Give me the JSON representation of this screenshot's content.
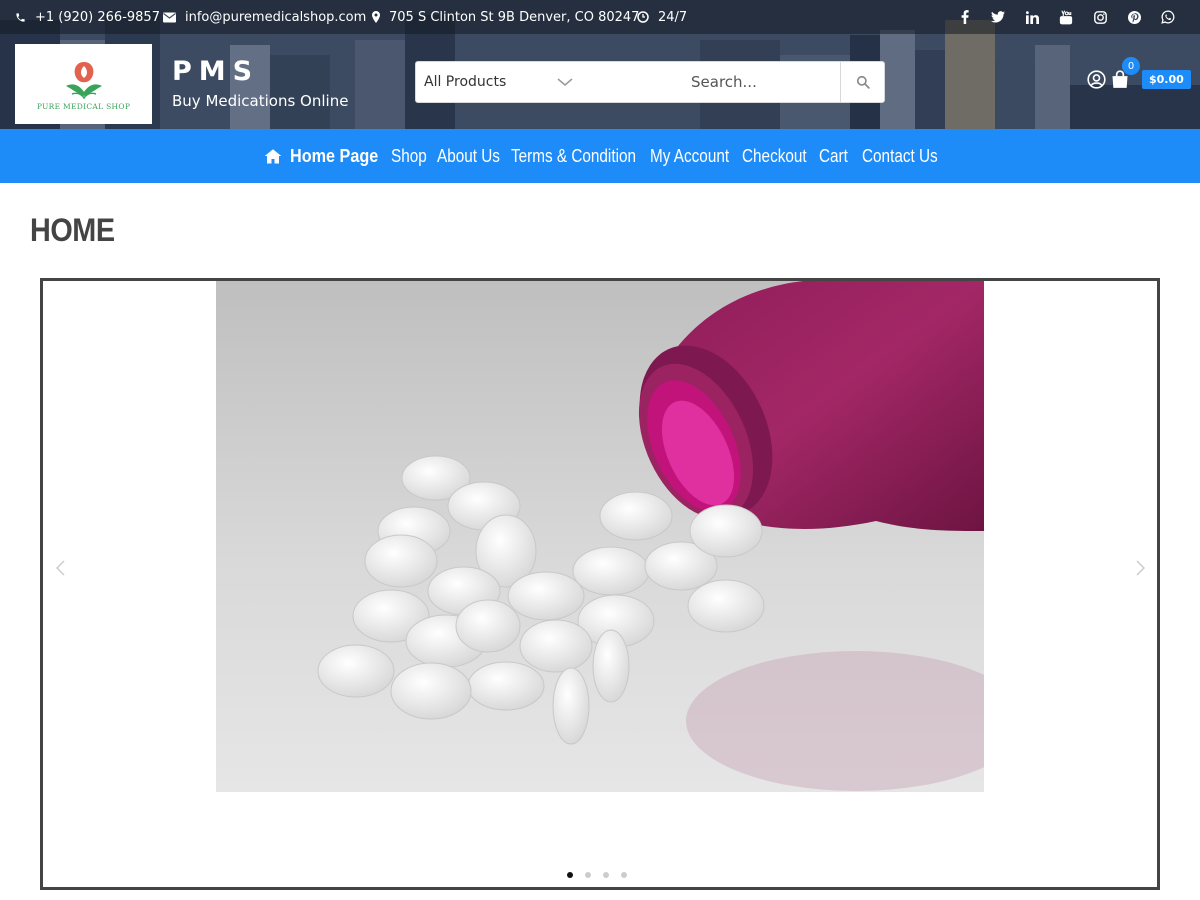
{
  "topbar": {
    "phone": "+1 (920) 266-9857",
    "email": "info@puremedicalshop.com",
    "address": "705 S Clinton St 9B Denver, CO 80247",
    "hours": "24/7",
    "social_icons": [
      "facebook-icon",
      "twitter-icon",
      "linkedin-icon",
      "youtube-icon",
      "instagram-icon",
      "pinterest-icon",
      "whatsapp-icon"
    ]
  },
  "brand": {
    "logo_text": "PURE MEDICAL SHOP",
    "title": "PMS",
    "tagline": "Buy Medications Online"
  },
  "search": {
    "category": "All Products",
    "placeholder": "Search..."
  },
  "cart": {
    "count": "0",
    "total": "$0.00"
  },
  "nav": {
    "items": [
      {
        "label": "Home Page",
        "active": true
      },
      {
        "label": "Shop"
      },
      {
        "label": "About Us"
      },
      {
        "label": "Terms & Condition"
      },
      {
        "label": "My Account"
      },
      {
        "label": "Checkout"
      },
      {
        "label": "Cart"
      },
      {
        "label": "Contact Us"
      }
    ]
  },
  "page": {
    "title": "HOME"
  },
  "slider": {
    "slide_count": 4,
    "active_slide": 1,
    "image": "white-pills-spilling-from-magenta-bottle"
  },
  "colors": {
    "accent": "#1e8cf8",
    "title": "#444444",
    "logo_green": "#3aa35a"
  }
}
